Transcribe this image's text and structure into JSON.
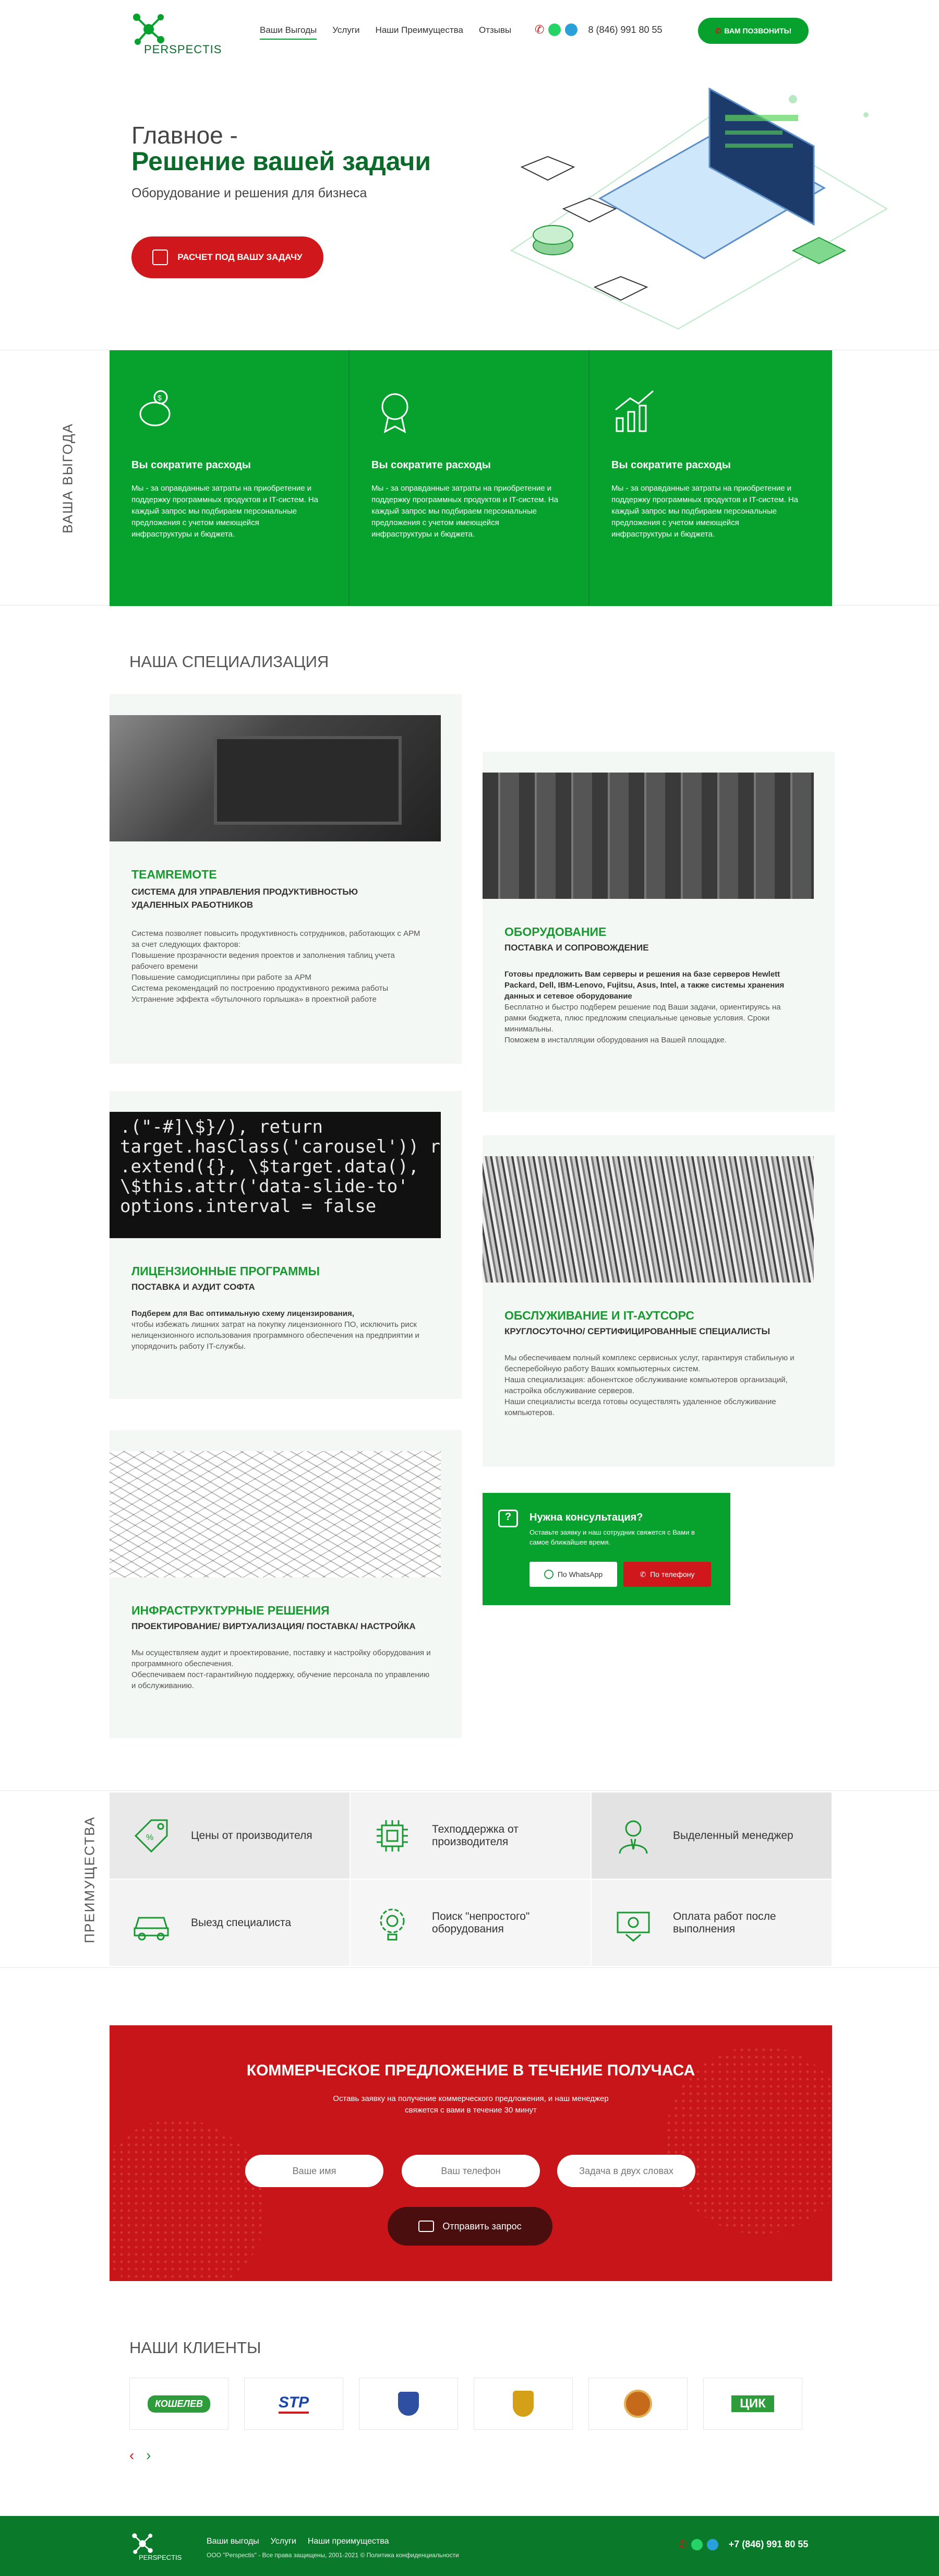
{
  "header": {
    "logo_text": "PERSPECTIS",
    "nav": [
      "Ваши Выгоды",
      "Услуги",
      "Наши Преимущества",
      "Отзывы"
    ],
    "phone": "8 (846) 991 80 55",
    "callback_label": "ВАМ ПОЗВОНИТЬ!"
  },
  "hero": {
    "title_line1": "Главное -",
    "title_line2": "Решение вашей задачи",
    "subtitle": "Оборудование и решения для бизнеса",
    "cta_label": "РАСЧЕТ ПОД ВАШУ ЗАДАЧУ"
  },
  "benefits": {
    "side_label": "ВАША ВЫГОДА",
    "items": [
      {
        "title": "Вы сократите расходы",
        "text": "Мы - за оправданные затраты на приобретение и поддержку программных продуктов и IT-систем. На каждый запрос мы подбираем персональные предложения с учетом имеющейся инфраструктуры и бюджета.",
        "icon": "piggy-bank"
      },
      {
        "title": "Вы сократите расходы",
        "text": "Мы - за оправданные затраты на приобретение и поддержку программных продуктов и IT-систем. На каждый запрос мы подбираем персональные предложения с учетом имеющейся инфраструктуры и бюджета.",
        "icon": "award-medal"
      },
      {
        "title": "Вы сократите расходы",
        "text": "Мы - за оправданные затраты на приобретение и поддержку программных продуктов и IT-систем. На каждый запрос мы подбираем персональные предложения с учетом имеющейся инфраструктуры и бюджета.",
        "icon": "growth-chart"
      }
    ]
  },
  "specialization": {
    "title": "НАША СПЕЦИАЛИЗАЦИЯ",
    "cards": [
      {
        "title": "TEAMREMOTE",
        "subtitle": "СИСТЕМА ДЛЯ УПРАВЛЕНИЯ ПРОДУКТИВНОСТЬЮ УДАЛЕННЫХ РАБОТНИКОВ",
        "lines": [
          "Система позволяет повысить продуктивность сотрудников, работающих с АРМ за счет следующих факторов:",
          "Повышение прозрачности ведения проектов и заполнения таблиц учета рабочего времени",
          "Повышение самодисциплины при работе за АРМ",
          "Система рекомендаций по построению продуктивного режима работы",
          "Устранение эффекта «бутылочного горлышка» в проектной работе"
        ]
      },
      {
        "title": "ОБОРУДОВАНИЕ",
        "subtitle": "ПОСТАВКА И СОПРОВОЖДЕНИЕ",
        "lines": [
          "Готовы предложить Вам серверы и решения на базе серверов Hewlett Packard, Dell, IBM-Lenovo, Fujitsu, Asus, Intel, а также системы хранения данных и сетевое оборудование",
          "Бесплатно и быстро подберем решение под Ваши задачи, ориентируясь на рамки бюджета, плюс предложим специальные ценовые условия. Сроки минимальны.",
          "Поможем в инсталляции оборудования на Вашей площадке."
        ]
      },
      {
        "title": "ЛИЦЕНЗИОННЫЕ ПРОГРАММЫ",
        "subtitle": "ПОСТАВКА И АУДИТ СОФТА",
        "lines": [
          "Подберем для Вас оптимальную схему лицензирования,",
          "чтобы избежать лишних затрат на покупку лицензионного ПО, исключить риск нелицензионного использования программного обеспечения на предприятии и упорядочить работу IT-службы."
        ]
      },
      {
        "title": "ОБСЛУЖИВАНИЕ И IT-АУТСОРС",
        "subtitle": "КРУГЛОСУТОЧНО/ СЕРТИФИЦИРОВАННЫЕ СПЕЦИАЛИСТЫ",
        "lines": [
          "Мы обеспечиваем полный комплекс сервисных услуг, гарантируя стабильную и бесперебойную работу Ваших компьютерных систем.",
          "Наша специализация: абонентское обслуживание компьютеров организаций, настройка обслуживание серверов.",
          "Наши специалисты всегда готовы осуществлять удаленное обслуживание компьютеров."
        ]
      },
      {
        "title": "ИНФРАСТРУКТУРНЫЕ РЕШЕНИЯ",
        "subtitle": "ПРОЕКТИРОВАНИЕ/ ВИРТУАЛИЗАЦИЯ/ ПОСТАВКА/ НАСТРОЙКА",
        "lines": [
          "Мы осуществляем аудит и проектирование, поставку и настройку оборудования и программного обеспечения.",
          "Обеспечиваем пост-гарантийную поддержку, обучение персонала по управлению и обслуживанию."
        ]
      }
    ],
    "consult": {
      "title": "Нужна консультация?",
      "text": "Оставьте заявку и наш сотрудник свяжется с Вами в самое ближайшее время.",
      "whatsapp_label": "По WhatsApp",
      "phone_label": "По телефону"
    }
  },
  "advantages": {
    "side_label": "ПРЕИМУЩЕСТВА",
    "items": [
      {
        "label": "Цены от производителя",
        "icon": "price-tag"
      },
      {
        "label": "Техподдержка от производителя",
        "icon": "chip"
      },
      {
        "label": "Выделенный менеджер",
        "icon": "manager"
      },
      {
        "label": "Выезд специалиста",
        "icon": "car"
      },
      {
        "label": "Поиск \"непростого\" оборудования",
        "icon": "gear-bulb"
      },
      {
        "label": "Оплата работ после выполнения",
        "icon": "payment"
      }
    ]
  },
  "offer": {
    "title": "КОММЕРЧЕСКОЕ ПРЕДЛОЖЕНИЕ В ТЕЧЕНИЕ ПОЛУЧАСА",
    "text_line1": "Оставь заявку на получение коммерческого предложения, и наш менеджер",
    "text_line2": "свяжется с вами в течение 30 минут",
    "name_placeholder": "Ваше имя",
    "phone_placeholder": "Ваш телефон",
    "task_placeholder": "Задача в двух словах",
    "submit_label": "Отправить запрос"
  },
  "clients": {
    "title": "НАШИ КЛИЕНТЫ",
    "logos": [
      "КОШЕЛЕВ",
      "STP",
      "emblem-1",
      "emblem-2",
      "emblem-3",
      "ЦИК"
    ]
  },
  "footer": {
    "logo_text": "PERSPECTIS",
    "nav": [
      "Ваши выгоды",
      "Услуги",
      "Наши преимущества"
    ],
    "copyright": "ООО \"Perspectis\" - Все права защищены, 2001-2021 © Политика конфиденциальности",
    "phone": "+7 (846) 991 80 55"
  },
  "colors": {
    "green": "#07a22e",
    "red": "#d0181c",
    "dark_green": "#0a6b2a"
  }
}
